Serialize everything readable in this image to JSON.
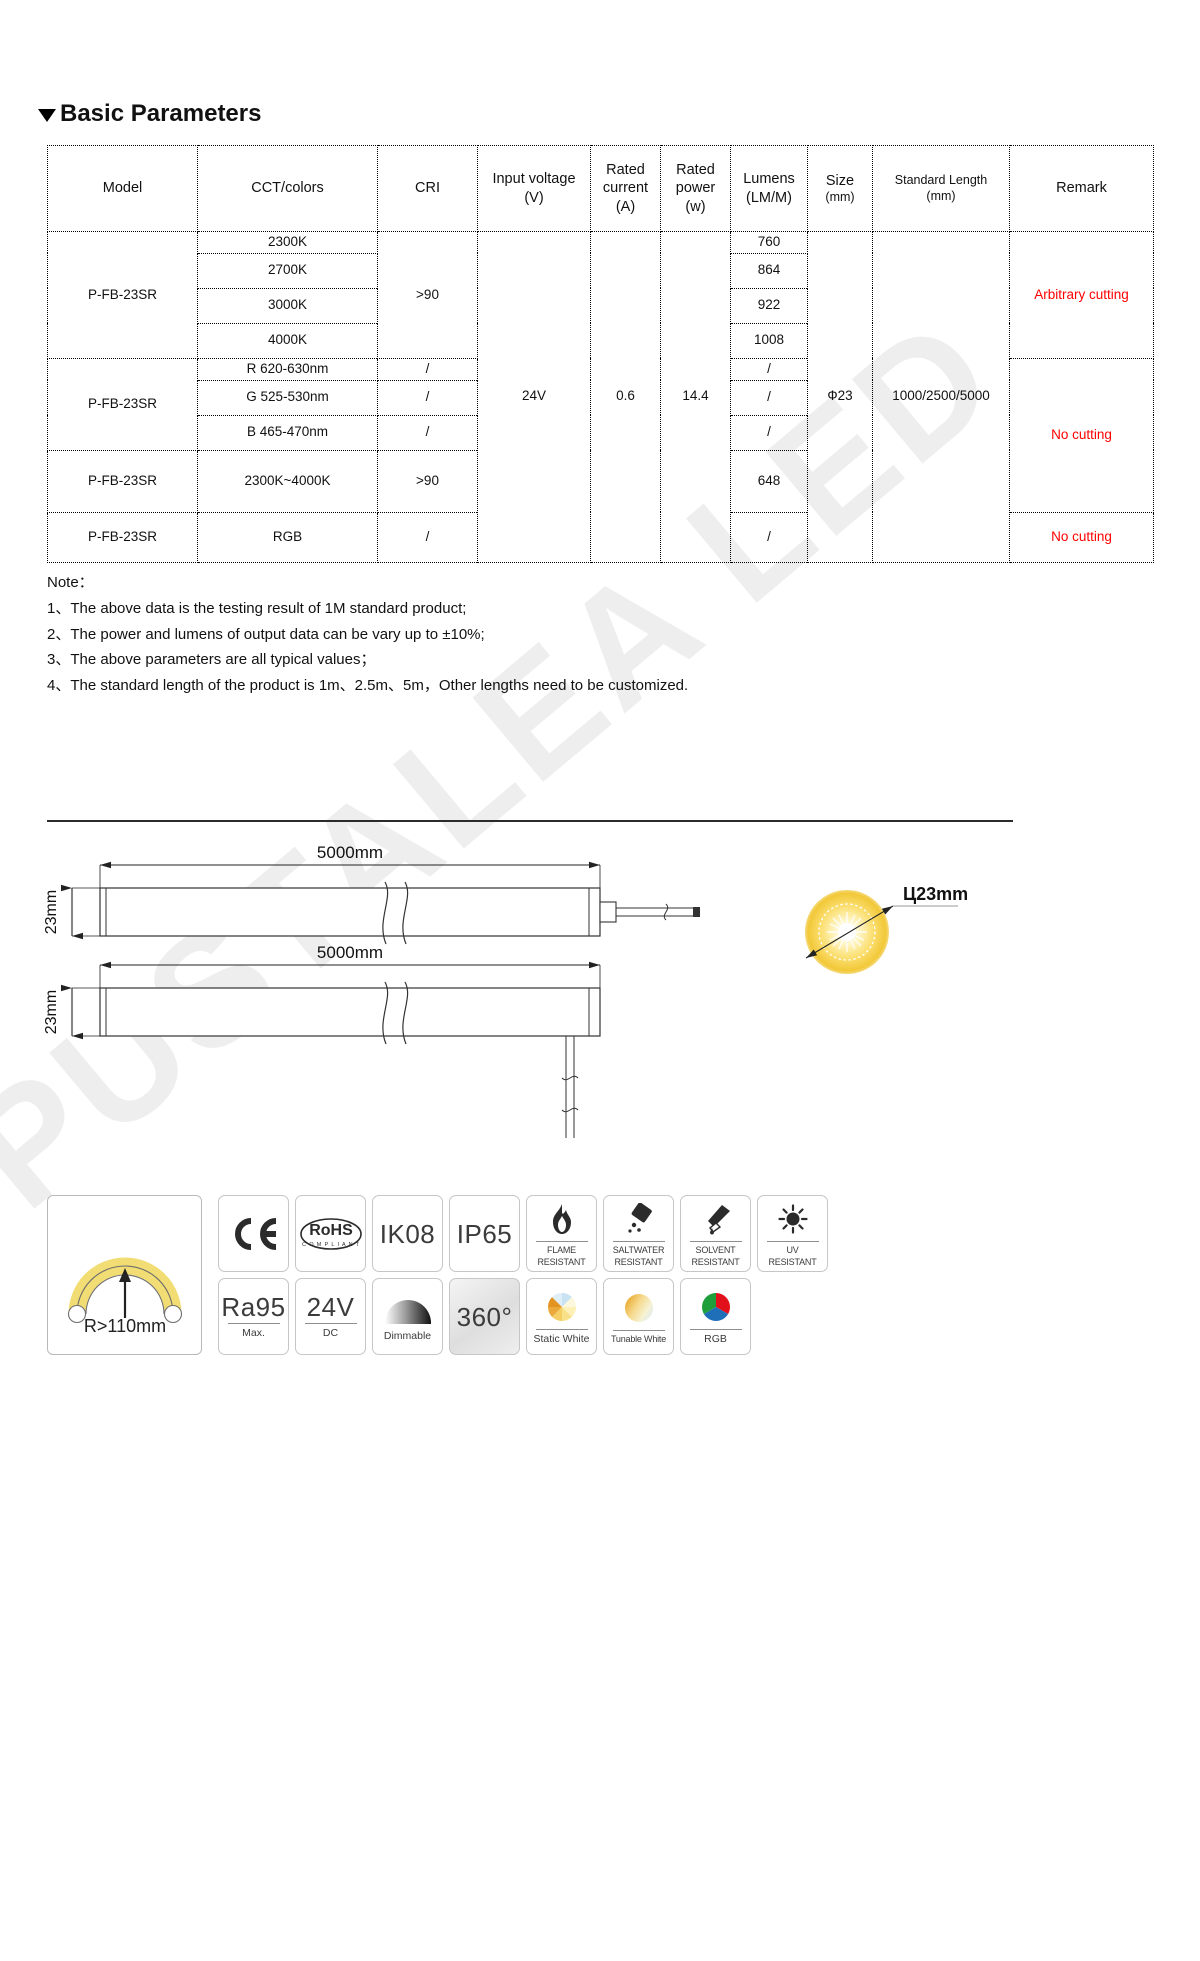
{
  "heading": {
    "title": "Basic Parameters",
    "toggle_icon": "triangle-down-icon"
  },
  "watermark": {
    "text": "PUSTALEA LED"
  },
  "table": {
    "headers": [
      {
        "label": "Model",
        "sub": ""
      },
      {
        "label": "CCT/colors",
        "sub": ""
      },
      {
        "label": "CRI",
        "sub": ""
      },
      {
        "label": "Input voltage",
        "sub": "(V)"
      },
      {
        "label": "Rated",
        "sub": "current",
        "sub2": "(A)"
      },
      {
        "label": "Rated",
        "sub": "power",
        "sub2": "(w)"
      },
      {
        "label": "Lumens",
        "sub": "(LM/M)"
      },
      {
        "label": "Size",
        "sub": "(mm)"
      },
      {
        "label": "Standard Length",
        "sub": "(mm)"
      },
      {
        "label": "Remark",
        "sub": ""
      }
    ],
    "shared": {
      "input_voltage": "24V",
      "rated_current": "0.6",
      "rated_power": "14.4",
      "size": "Ф23",
      "standard_length": "1000/2500/5000"
    },
    "groups": [
      {
        "model": "P-FB-23SR",
        "cri": ">90",
        "remark": "Arbitrary cutting",
        "remark_color": "#ff0000",
        "rows": [
          {
            "cct": "2300K",
            "lumens": "760"
          },
          {
            "cct": "2700K",
            "lumens": "864"
          },
          {
            "cct": "3000K",
            "lumens": "922"
          },
          {
            "cct": "4000K",
            "lumens": "1008"
          }
        ]
      },
      {
        "model": "P-FB-23SR",
        "cri": null,
        "remark": "No cutting",
        "remark_color": "#ff0000",
        "rows": [
          {
            "cct": "R 620-630nm",
            "cri": "/",
            "lumens": "/"
          },
          {
            "cct": "G 525-530nm",
            "cri": "/",
            "lumens": "/"
          },
          {
            "cct": "B 465-470nm",
            "cri": "/",
            "lumens": "/"
          }
        ]
      },
      {
        "model": "P-FB-23SR",
        "cri": ">90",
        "remark": "",
        "rows": [
          {
            "cct": "2300K~4000K",
            "lumens": "648"
          }
        ]
      },
      {
        "model": "P-FB-23SR",
        "cri": "/",
        "remark": "No cutting",
        "remark_color": "#ff0000",
        "rows": [
          {
            "cct": "RGB",
            "lumens": "/"
          }
        ]
      }
    ]
  },
  "note": {
    "title": "Note：",
    "lines": [
      "1、The above data is the testing result of 1M standard product;",
      "2、The power and lumens of output data can be vary up to ±10%;",
      "3、The above parameters are all typical values；",
      "4、The standard length of the product is 1m、2.5m、5m，Other lengths need to be customized."
    ]
  },
  "drawing": {
    "top_length_label": "5000mm",
    "top_height_label": "23mm",
    "bottom_length_label": "5000mm",
    "bottom_height_label": "23mm",
    "diameter_label": "Ц23mm"
  },
  "bend": {
    "label": "R>110mm"
  },
  "badges_row1": [
    {
      "name": "ce-badge",
      "type": "glyph",
      "big": "C E",
      "cap": ""
    },
    {
      "name": "rohs-badge",
      "type": "rohs",
      "big": "RoHS",
      "cap": "C O M P L I A N T"
    },
    {
      "name": "ik08-badge",
      "type": "text",
      "big": "IK08",
      "cap": ""
    },
    {
      "name": "ip65-badge",
      "type": "text",
      "big": "IP65",
      "cap": ""
    },
    {
      "name": "flame-resistant-badge",
      "type": "icon",
      "icon": "flame-icon",
      "cap": "FLAME",
      "cap2": "RESISTANT"
    },
    {
      "name": "saltwater-resistant-badge",
      "type": "icon",
      "icon": "salt-shaker-icon",
      "cap": "SALTWATER",
      "cap2": "RESISTANT"
    },
    {
      "name": "solvent-resistant-badge",
      "type": "icon",
      "icon": "dropper-icon",
      "cap": "SOLVENT",
      "cap2": "RESISTANT"
    },
    {
      "name": "uv-resistant-badge",
      "type": "icon",
      "icon": "sun-icon",
      "cap": "UV",
      "cap2": "RESISTANT"
    }
  ],
  "badges_row2": [
    {
      "name": "ra95-badge",
      "type": "text",
      "big": "Ra95",
      "cap": "Max."
    },
    {
      "name": "voltage-badge",
      "type": "text",
      "big": "24V",
      "cap": "DC"
    },
    {
      "name": "dimmable-badge",
      "type": "icon",
      "icon": "dimming-arc-icon",
      "cap": "Dimmable"
    },
    {
      "name": "beam-angle-badge",
      "type": "text",
      "big": "360°",
      "cap": ""
    },
    {
      "name": "static-white-badge",
      "type": "icon",
      "icon": "color-wheel-icon",
      "cap": "Static White"
    },
    {
      "name": "tunable-white-badge",
      "type": "icon",
      "icon": "gradient-circle-icon",
      "cap": "Tunable White"
    },
    {
      "name": "rgb-badge",
      "type": "icon",
      "icon": "rgb-pie-icon",
      "cap": "RGB"
    }
  ]
}
